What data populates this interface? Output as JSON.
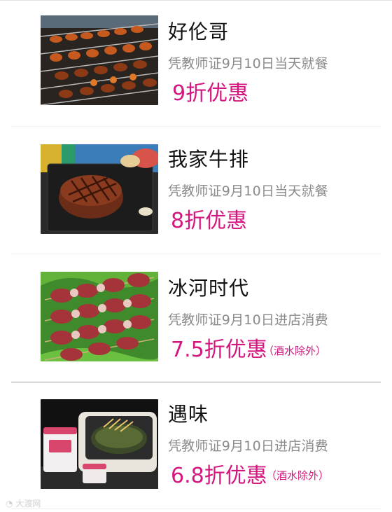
{
  "items": [
    {
      "name": "好伦哥",
      "condition": "凭教师证9月10日当天就餐",
      "discount": "9折优惠",
      "note": "",
      "image_icon": "bbq-skewers-image"
    },
    {
      "name": "我家牛排",
      "condition": "凭教师证9月10日当天就餐",
      "discount": "8折优惠",
      "note": "",
      "image_icon": "steak-image"
    },
    {
      "name": "冰河时代",
      "condition": "凭教师证9月10日进店消费",
      "discount": "7.5折优惠",
      "note": "（酒水除外）",
      "image_icon": "meat-skewers-image"
    },
    {
      "name": "遇味",
      "condition": "凭教师证9月10日进店消费",
      "discount": "6.8折优惠",
      "note": "（酒水除外）",
      "image_icon": "grilled-fish-image"
    }
  ],
  "watermark": "大渡网",
  "accent_color": "#d4167e"
}
